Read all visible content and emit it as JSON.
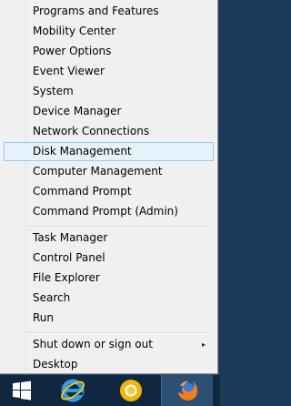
{
  "menu": {
    "items": [
      {
        "label": "Programs and Features"
      },
      {
        "label": "Mobility Center"
      },
      {
        "label": "Power Options"
      },
      {
        "label": "Event Viewer"
      },
      {
        "label": "System"
      },
      {
        "label": "Device Manager"
      },
      {
        "label": "Network Connections"
      },
      {
        "label": "Disk Management",
        "selected": true
      },
      {
        "label": "Computer Management"
      },
      {
        "label": "Command Prompt"
      },
      {
        "label": "Command Prompt (Admin)"
      },
      {
        "label": "Task Manager"
      },
      {
        "label": "Control Panel"
      },
      {
        "label": "File Explorer"
      },
      {
        "label": "Search"
      },
      {
        "label": "Run"
      },
      {
        "label": "Shut down or sign out",
        "has_submenu": true
      },
      {
        "label": "Desktop"
      }
    ],
    "submenu_arrow": "▸"
  },
  "taskbar": {
    "icons": [
      "windows-logo-icon",
      "internet-explorer-icon",
      "chrome-canary-icon",
      "firefox-icon"
    ]
  },
  "colors": {
    "menu_bg": "#f0f0f0",
    "selected_bg": "#e5f1fb",
    "selected_border": "#99c9ef",
    "taskbar_bg": "#0f2741"
  }
}
